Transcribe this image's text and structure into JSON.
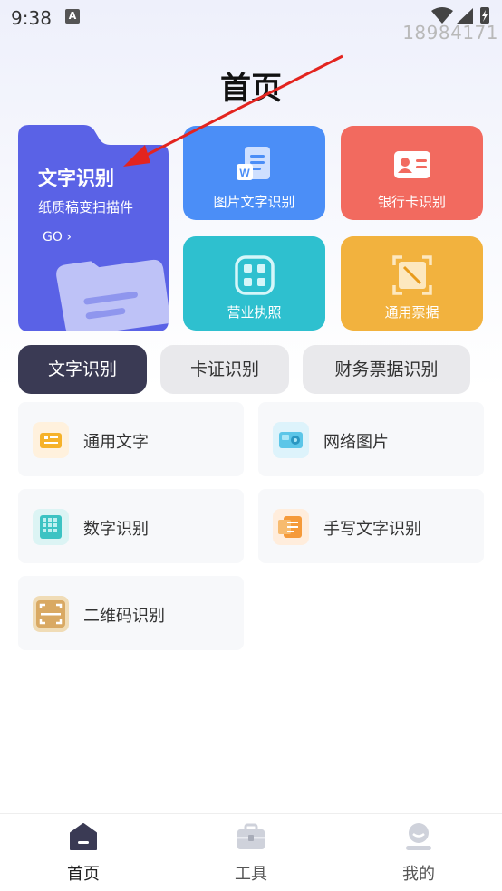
{
  "status_bar": {
    "time": "9:38",
    "notification_icon": "A",
    "watermark": "18984171"
  },
  "page": {
    "title": "首页"
  },
  "feature_cards": {
    "big": {
      "title": "文字识别",
      "subtitle": "纸质稿变扫描件",
      "go": "GO",
      "color": "#5a62e6"
    },
    "tiles": [
      {
        "label": "图片文字识别",
        "icon": "word-doc-icon",
        "color": "#4b8ef7"
      },
      {
        "label": "银行卡识别",
        "icon": "id-card-icon",
        "color": "#f26a5f"
      },
      {
        "label": "营业执照",
        "icon": "scan-frame-icon",
        "color": "#2ec0cf"
      },
      {
        "label": "通用票据",
        "icon": "receipt-icon",
        "color": "#f2b23e"
      }
    ]
  },
  "tabs": [
    {
      "label": "文字识别",
      "active": true
    },
    {
      "label": "卡证识别",
      "active": false
    },
    {
      "label": "财务票据识别",
      "active": false
    }
  ],
  "items": [
    {
      "label": "通用文字",
      "icon": "general-text-icon"
    },
    {
      "label": "网络图片",
      "icon": "web-image-icon"
    },
    {
      "label": "数字识别",
      "icon": "number-grid-icon"
    },
    {
      "label": "手写文字识别",
      "icon": "handwriting-icon"
    },
    {
      "label": "二维码识别",
      "icon": "qr-scan-icon"
    }
  ],
  "bottom_nav": [
    {
      "label": "首页",
      "icon": "home-icon",
      "active": true
    },
    {
      "label": "工具",
      "icon": "toolbox-icon",
      "active": false
    },
    {
      "label": "我的",
      "icon": "profile-icon",
      "active": false
    }
  ]
}
